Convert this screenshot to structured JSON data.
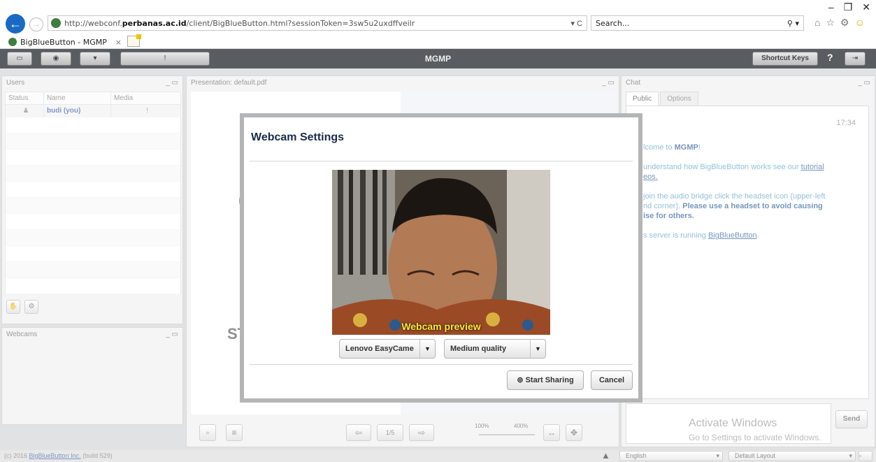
{
  "browser": {
    "url_prefix": "http://webconf.",
    "url_host": "perbanas.ac.id",
    "url_path": "/client/BigBlueButton.html?sessionToken=3sw5u2uxdffveilr",
    "address_tools": "▾ C",
    "search_placeholder": "Search...",
    "search_icon": "⚲ ▾",
    "tab_title": "BigBlueButton - MGMP",
    "tab_close": "×",
    "window_controls": {
      "minimize": "–",
      "restore": "❐",
      "close": "✕"
    },
    "toolbar_icons": {
      "home": "⌂",
      "favorites": "☆",
      "settings": "⚙",
      "feedback": "☺"
    },
    "back_icon": "←",
    "forward_icon": "→"
  },
  "app": {
    "title": "MGMP",
    "toolbar": {
      "shortcut_keys": "Shortcut Keys",
      "help": "?",
      "mic_label": "!"
    }
  },
  "users_panel": {
    "title": "Users",
    "controls": "_ ▭",
    "columns": {
      "status": "Status",
      "name": "Name",
      "media": "Media"
    },
    "users": [
      {
        "status_icon": "♟",
        "name": "budi (you)",
        "media_icon": "!"
      }
    ]
  },
  "webcams_panel": {
    "title": "Webcams",
    "controls": "_ ▭"
  },
  "presentation_panel": {
    "title": "Presentation: default.pdf",
    "controls": "_ ▭",
    "glyphs": {
      "c_fragment": "(",
      "st_fragment": "ST"
    },
    "page": "1/5",
    "zoom_min": "100%",
    "zoom_max": "400%"
  },
  "chat_panel": {
    "title": "Chat",
    "controls": "_ ▭",
    "tabs": [
      "Public",
      "Options"
    ],
    "time": "17:34",
    "messages": {
      "welcome_pre": "lcome to ",
      "welcome_name": "MGMP",
      "welcome_post": "!",
      "tutorial_pre": "understand how BigBlueButton works see our ",
      "tutorial_link": "tutorial",
      "tutorial_post": "eos.",
      "audio_line1": "join the audio bridge click the headset icon (upper-left",
      "audio_line2_pre": "nd corner). ",
      "audio_line2_bold": "Please use a headset to avoid causing",
      "audio_line3_bold": "ise for others.",
      "server_pre": "s server is running ",
      "server_link": "BigBlueButton",
      "server_post": "."
    },
    "send": "Send",
    "watermark_title": "Activate Windows",
    "watermark_sub": "Go to Settings to activate Windows."
  },
  "status_bar": {
    "credit_pre": "(c) 2016 ",
    "credit_link": "BigBlueButton Inc.",
    "credit_post": " (build 529)",
    "language": "English",
    "layout": "Default Layout"
  },
  "modal": {
    "title": "Webcam Settings",
    "preview_caption": "Webcam preview",
    "camera_select": "Lenovo EasyCame",
    "quality_select": "Medium quality",
    "start_sharing": "Start Sharing",
    "cancel": "Cancel",
    "dropdown_arrow": "▼"
  },
  "colors": {
    "toolbar_bg": "#595c60",
    "title_text": "#1c2a4a",
    "preview_caption": "#f5e93a",
    "link_blue": "#2d5e9a"
  }
}
